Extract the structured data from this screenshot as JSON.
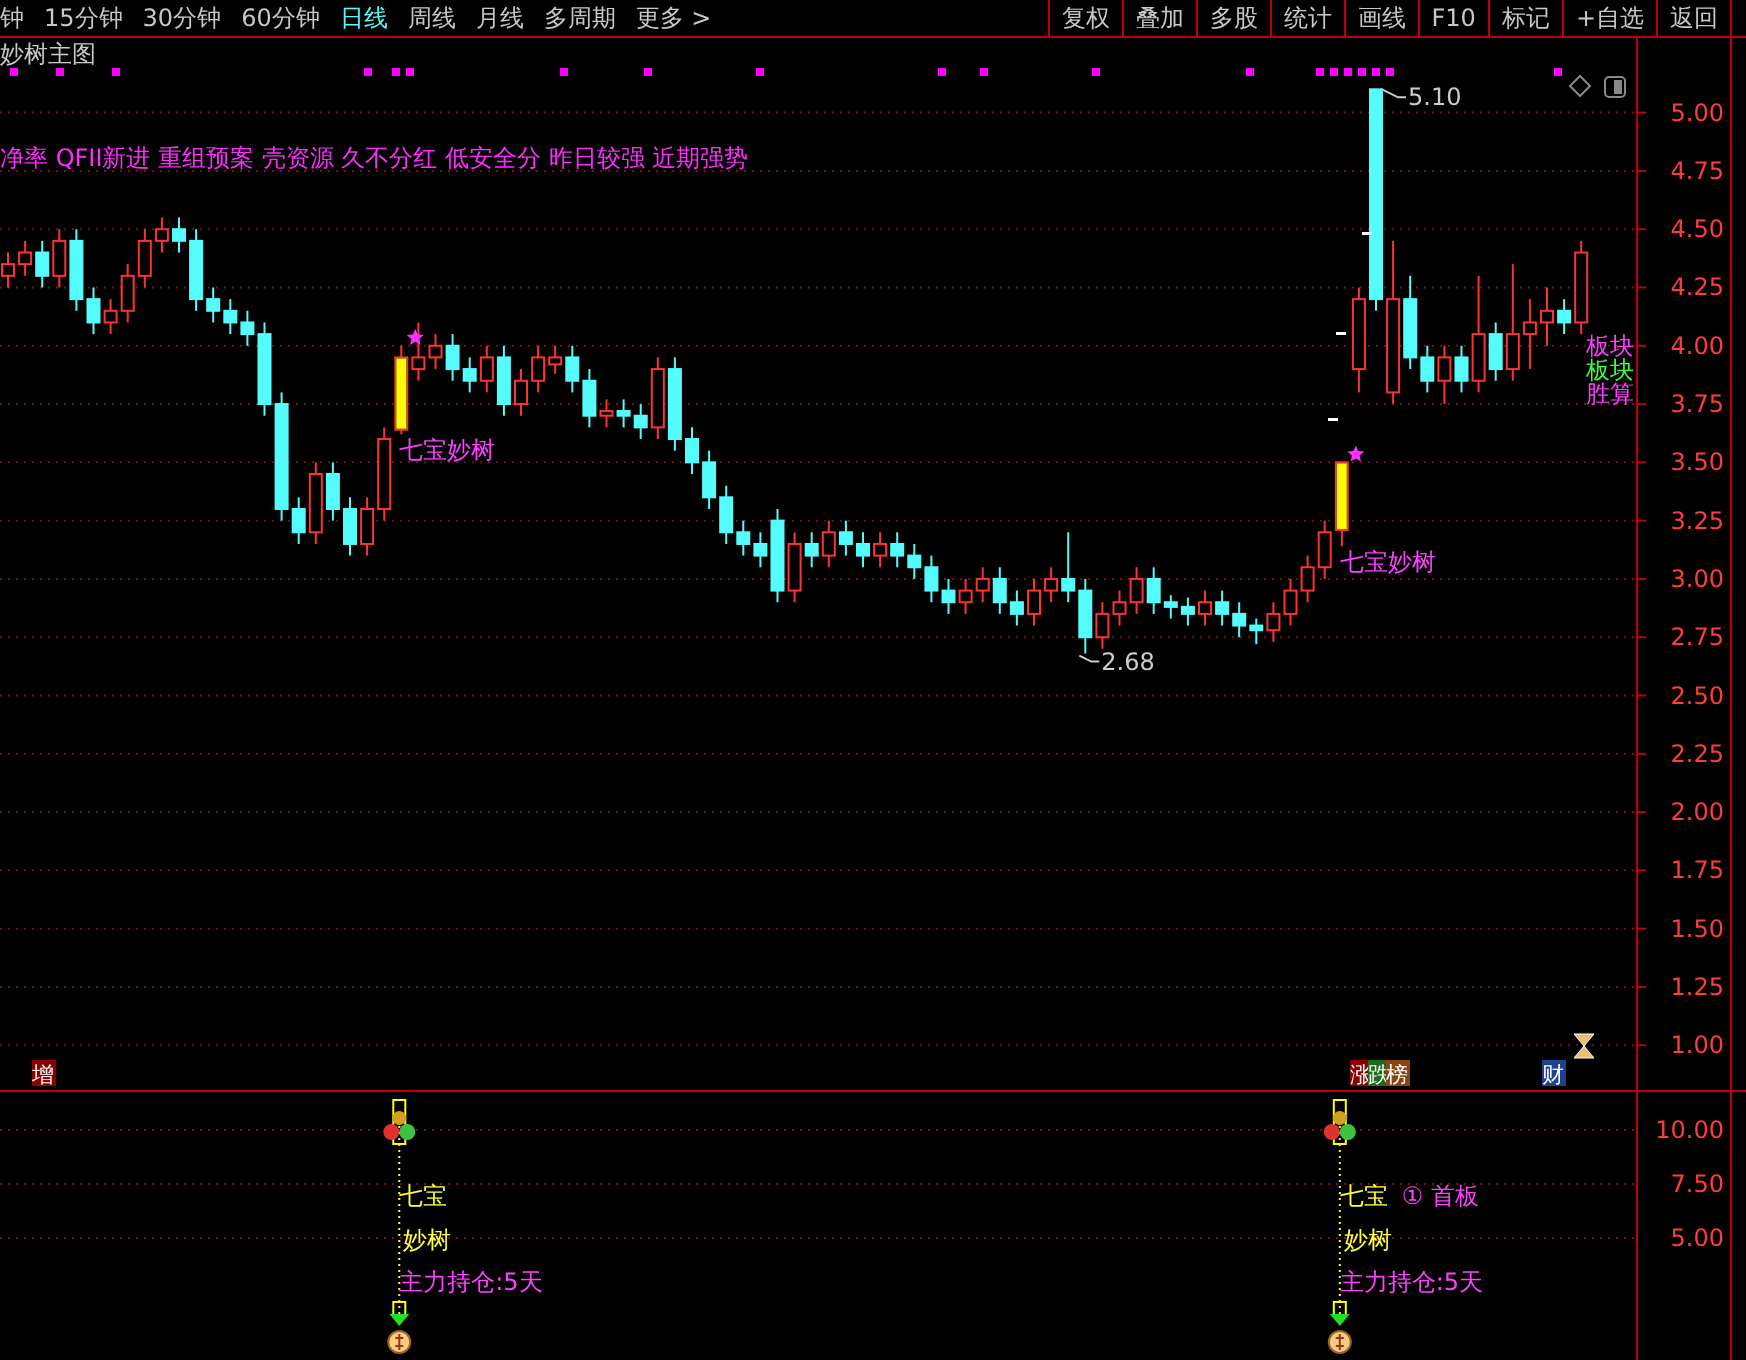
{
  "toolbar": {
    "periods": [
      {
        "label": "钟",
        "selected": false
      },
      {
        "label": "15分钟",
        "selected": false
      },
      {
        "label": "30分钟",
        "selected": false
      },
      {
        "label": "60分钟",
        "selected": false
      },
      {
        "label": "日线",
        "selected": true
      },
      {
        "label": "周线",
        "selected": false
      },
      {
        "label": "月线",
        "selected": false
      },
      {
        "label": "多周期",
        "selected": false
      },
      {
        "label": "更多 >",
        "selected": false
      }
    ],
    "buttons": [
      "复权",
      "叠加",
      "多股",
      "统计",
      "画线",
      "F10",
      "标记",
      "+自选",
      "返回"
    ]
  },
  "main_panel": {
    "title": "妙树主图",
    "tags": "净率 QFII新进 重组预案 壳资源 久不分红 低安全分 昨日较强 近期强势",
    "side_labels": [
      {
        "text": "板块",
        "color": "#ff40ff"
      },
      {
        "text": "板块",
        "color": "#40ff40"
      },
      {
        "text": "胜算",
        "color": "#ff40ff"
      }
    ],
    "badge_groups": [
      [
        {
          "text": "增",
          "color": "#8b0000"
        }
      ],
      [
        {
          "text": "涨",
          "color": "#8b0000"
        },
        {
          "text": "跌",
          "color": "#1a6b1a"
        },
        {
          "text": "榜",
          "color": "#8b4513"
        }
      ],
      [
        {
          "text": "财",
          "color": "#1f3f8f"
        }
      ]
    ],
    "chart_data": {
      "type": "candlestick",
      "ylim": [
        -0.35,
        5.32
      ],
      "grid": true,
      "yticks": [
        {
          "value": 5,
          "label": "5.00"
        },
        {
          "value": 4.75,
          "label": "4.75"
        },
        {
          "value": 4.5,
          "label": "4.50"
        },
        {
          "value": 4.25,
          "label": "4.25"
        },
        {
          "value": 4,
          "label": "4.00"
        },
        {
          "value": 3.75,
          "label": "3.75"
        },
        {
          "value": 3.5,
          "label": "3.50"
        },
        {
          "value": 3.25,
          "label": "3.25"
        },
        {
          "value": 3,
          "label": "3.00"
        },
        {
          "value": 2.75,
          "label": "2.75"
        },
        {
          "value": 2.5,
          "label": "2.50"
        },
        {
          "value": 2.25,
          "label": "2.25"
        },
        {
          "value": 2,
          "label": "2.00"
        },
        {
          "value": 1.75,
          "label": "1.75"
        },
        {
          "value": 1.5,
          "label": "1.50"
        },
        {
          "value": 1.25,
          "label": "1.25"
        },
        {
          "value": 1,
          "label": "1.00"
        }
      ],
      "ohlc": [
        [
          4.3,
          4.4,
          4.25,
          4.35
        ],
        [
          4.35,
          4.45,
          4.3,
          4.4
        ],
        [
          4.4,
          4.45,
          4.25,
          4.3
        ],
        [
          4.3,
          4.5,
          4.25,
          4.45
        ],
        [
          4.45,
          4.5,
          4.15,
          4.2
        ],
        [
          4.2,
          4.25,
          4.05,
          4.1
        ],
        [
          4.1,
          4.2,
          4.05,
          4.15
        ],
        [
          4.15,
          4.35,
          4.1,
          4.3
        ],
        [
          4.3,
          4.5,
          4.25,
          4.45
        ],
        [
          4.45,
          4.55,
          4.4,
          4.5
        ],
        [
          4.5,
          4.55,
          4.4,
          4.45
        ],
        [
          4.45,
          4.5,
          4.15,
          4.2
        ],
        [
          4.2,
          4.25,
          4.1,
          4.15
        ],
        [
          4.15,
          4.2,
          4.05,
          4.1
        ],
        [
          4.1,
          4.15,
          4.0,
          4.05
        ],
        [
          4.05,
          4.1,
          3.7,
          3.75
        ],
        [
          3.75,
          3.8,
          3.25,
          3.3
        ],
        [
          3.3,
          3.35,
          3.15,
          3.2
        ],
        [
          3.2,
          3.5,
          3.15,
          3.45
        ],
        [
          3.45,
          3.5,
          3.25,
          3.3
        ],
        [
          3.3,
          3.35,
          3.1,
          3.15
        ],
        [
          3.15,
          3.35,
          3.1,
          3.3
        ],
        [
          3.3,
          3.65,
          3.25,
          3.6
        ],
        [
          3.64,
          4.0,
          3.62,
          3.95
        ],
        [
          3.9,
          4.1,
          3.85,
          3.95
        ],
        [
          3.95,
          4.05,
          3.9,
          4.0
        ],
        [
          4.0,
          4.05,
          3.85,
          3.9
        ],
        [
          3.9,
          3.95,
          3.8,
          3.85
        ],
        [
          3.85,
          4.0,
          3.8,
          3.95
        ],
        [
          3.95,
          4.0,
          3.7,
          3.75
        ],
        [
          3.75,
          3.9,
          3.7,
          3.85
        ],
        [
          3.85,
          4.0,
          3.8,
          3.95
        ],
        [
          3.92,
          4.0,
          3.88,
          3.95
        ],
        [
          3.95,
          4.0,
          3.8,
          3.85
        ],
        [
          3.85,
          3.9,
          3.65,
          3.7
        ],
        [
          3.7,
          3.77,
          3.65,
          3.72
        ],
        [
          3.72,
          3.77,
          3.65,
          3.7
        ],
        [
          3.7,
          3.75,
          3.6,
          3.65
        ],
        [
          3.65,
          3.95,
          3.6,
          3.9
        ],
        [
          3.9,
          3.95,
          3.55,
          3.6
        ],
        [
          3.6,
          3.65,
          3.45,
          3.5
        ],
        [
          3.5,
          3.55,
          3.3,
          3.35
        ],
        [
          3.35,
          3.4,
          3.15,
          3.2
        ],
        [
          3.2,
          3.25,
          3.1,
          3.15
        ],
        [
          3.15,
          3.2,
          3.05,
          3.1
        ],
        [
          3.25,
          3.3,
          2.9,
          2.95
        ],
        [
          2.95,
          3.2,
          2.9,
          3.15
        ],
        [
          3.15,
          3.2,
          3.05,
          3.1
        ],
        [
          3.1,
          3.25,
          3.05,
          3.2
        ],
        [
          3.2,
          3.25,
          3.1,
          3.15
        ],
        [
          3.15,
          3.2,
          3.05,
          3.1
        ],
        [
          3.1,
          3.2,
          3.05,
          3.15
        ],
        [
          3.15,
          3.2,
          3.05,
          3.1
        ],
        [
          3.1,
          3.15,
          3.0,
          3.05
        ],
        [
          3.05,
          3.1,
          2.9,
          2.95
        ],
        [
          2.95,
          3.0,
          2.85,
          2.9
        ],
        [
          2.9,
          3.0,
          2.85,
          2.95
        ],
        [
          2.95,
          3.05,
          2.9,
          3.0
        ],
        [
          3.0,
          3.05,
          2.85,
          2.9
        ],
        [
          2.9,
          2.95,
          2.8,
          2.85
        ],
        [
          2.85,
          3.0,
          2.8,
          2.95
        ],
        [
          2.95,
          3.05,
          2.9,
          3.0
        ],
        [
          3.0,
          3.2,
          2.9,
          2.95
        ],
        [
          2.95,
          3.0,
          2.68,
          2.75
        ],
        [
          2.75,
          2.9,
          2.7,
          2.85
        ],
        [
          2.85,
          2.95,
          2.8,
          2.9
        ],
        [
          2.9,
          3.05,
          2.85,
          3.0
        ],
        [
          3.0,
          3.05,
          2.85,
          2.9
        ],
        [
          2.9,
          2.93,
          2.83,
          2.88
        ],
        [
          2.88,
          2.92,
          2.8,
          2.85
        ],
        [
          2.85,
          2.95,
          2.8,
          2.9
        ],
        [
          2.9,
          2.95,
          2.8,
          2.85
        ],
        [
          2.85,
          2.9,
          2.75,
          2.8
        ],
        [
          2.8,
          2.83,
          2.72,
          2.78
        ],
        [
          2.78,
          2.9,
          2.73,
          2.85
        ],
        [
          2.85,
          3.0,
          2.8,
          2.95
        ],
        [
          2.95,
          3.1,
          2.9,
          3.05
        ],
        [
          3.05,
          3.25,
          3.0,
          3.2
        ],
        [
          3.21,
          3.5,
          3.14,
          3.5
        ],
        [
          3.9,
          4.25,
          3.8,
          4.2
        ],
        [
          5.1,
          5.1,
          4.15,
          4.2
        ],
        [
          3.8,
          4.45,
          3.75,
          4.2
        ],
        [
          4.2,
          4.3,
          3.9,
          3.95
        ],
        [
          3.95,
          4.0,
          3.8,
          3.85
        ],
        [
          3.85,
          4.0,
          3.75,
          3.95
        ],
        [
          3.95,
          4.0,
          3.8,
          3.85
        ],
        [
          3.85,
          4.3,
          3.8,
          4.05
        ],
        [
          4.05,
          4.1,
          3.85,
          3.9
        ],
        [
          3.9,
          4.35,
          3.85,
          4.05
        ],
        [
          4.05,
          4.2,
          3.9,
          4.1
        ],
        [
          4.1,
          4.25,
          4.0,
          4.15
        ],
        [
          4.15,
          4.2,
          4.05,
          4.1
        ],
        [
          4.1,
          4.45,
          4.05,
          4.4
        ]
      ],
      "annotations": [
        "七宝妙树",
        "2.68",
        "七宝妙树",
        "5.10"
      ]
    }
  },
  "indicator_panel": {
    "axis_labels": [
      "10.00",
      "7.50",
      "5.00"
    ],
    "signals": [
      {
        "color": "#ffff00",
        "line_1": "七宝",
        "line_2": "妙树",
        "line_3": "主力持仓:5天"
      },
      {
        "color": "#ffff00",
        "line_1": "七宝",
        "tag": "① 首板",
        "line_2": "妙树",
        "line_3": "主力持仓:5天"
      }
    ]
  }
}
